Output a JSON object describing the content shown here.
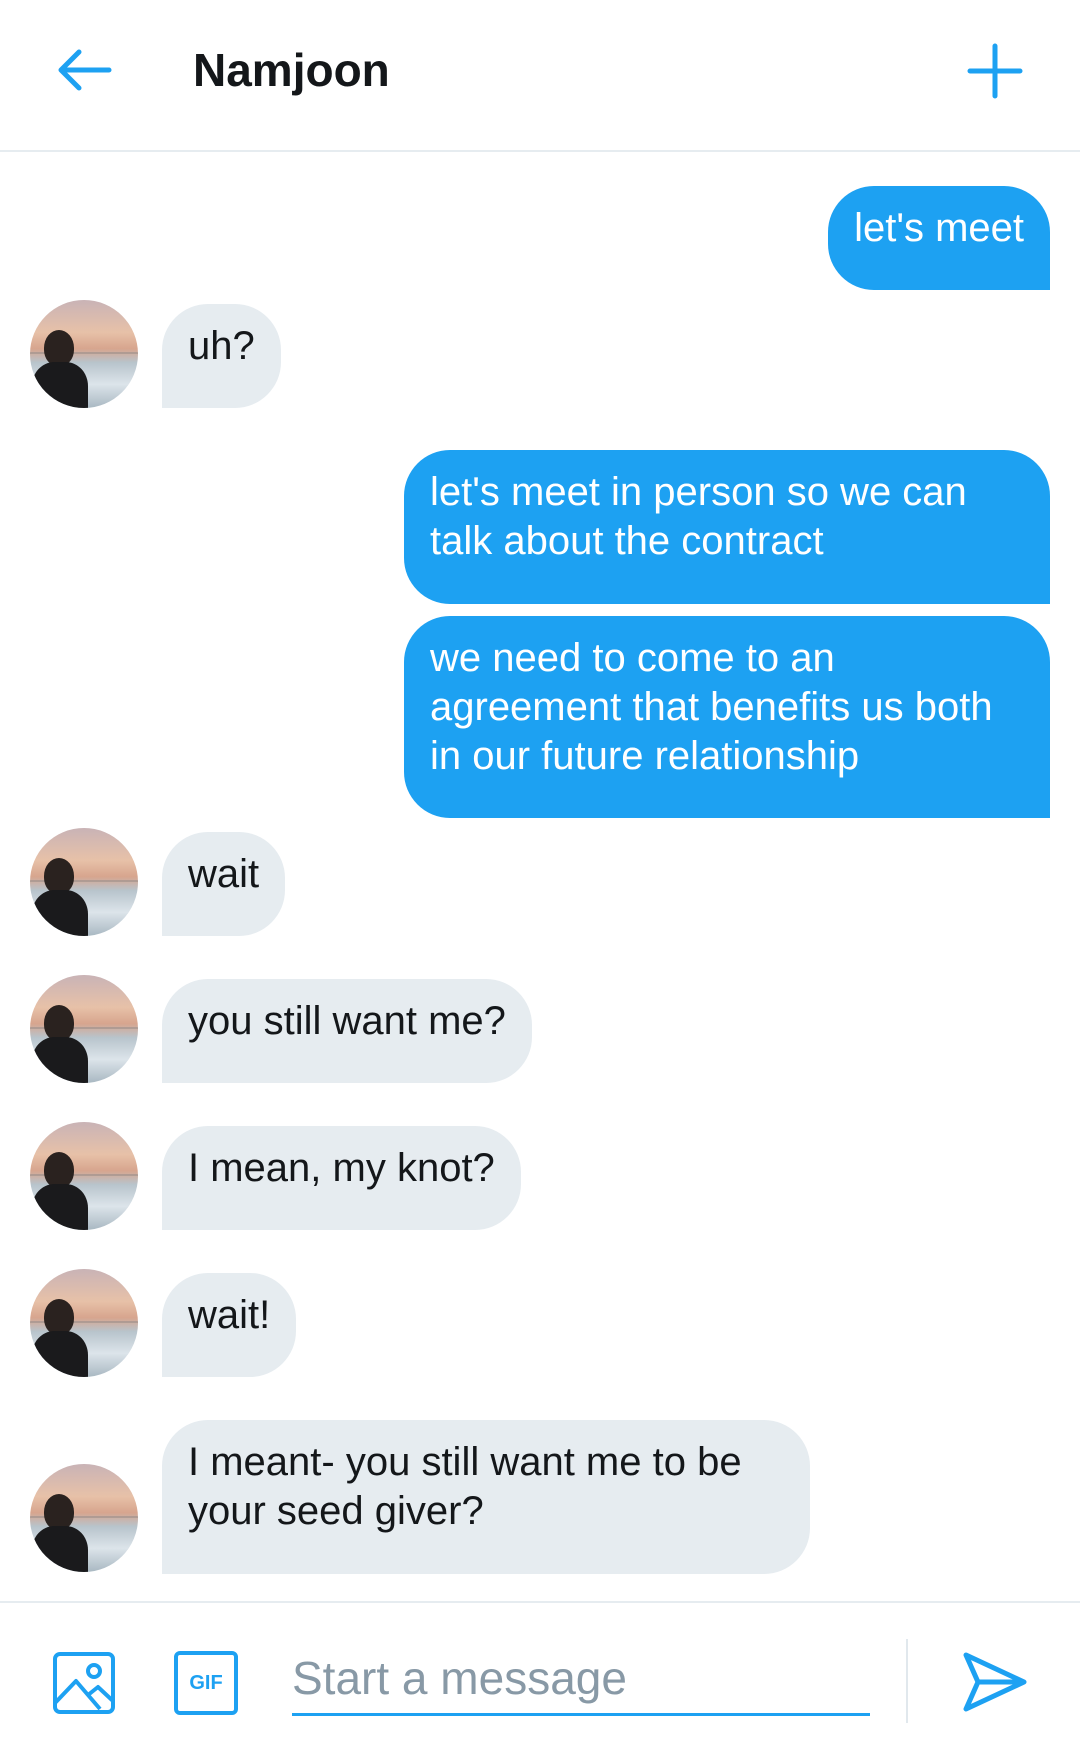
{
  "header": {
    "title": "Namjoon",
    "back_icon": "arrow-left-icon",
    "new_icon": "plus-icon"
  },
  "messages": [
    {
      "dir": "out",
      "text": "let's meet"
    },
    {
      "dir": "in",
      "text": "uh?"
    },
    {
      "dir": "out",
      "text": "let's meet in person so we can talk about the contract"
    },
    {
      "dir": "out",
      "text": "we need to come to an agreement that benefits us both in our future relationship"
    },
    {
      "dir": "in",
      "text": "wait"
    },
    {
      "dir": "in",
      "text": "you still want me?"
    },
    {
      "dir": "in",
      "text": "I mean, my knot?"
    },
    {
      "dir": "in",
      "text": "wait!"
    },
    {
      "dir": "in",
      "text": "I meant- you still want me to be your seed giver?"
    }
  ],
  "composer": {
    "placeholder": "Start a message",
    "gif_label": "GIF",
    "image_icon": "image-icon",
    "send_icon": "send-icon"
  },
  "colors": {
    "accent": "#1da1f2",
    "incoming_bubble": "#e6ecf0",
    "text": "#14171a"
  }
}
